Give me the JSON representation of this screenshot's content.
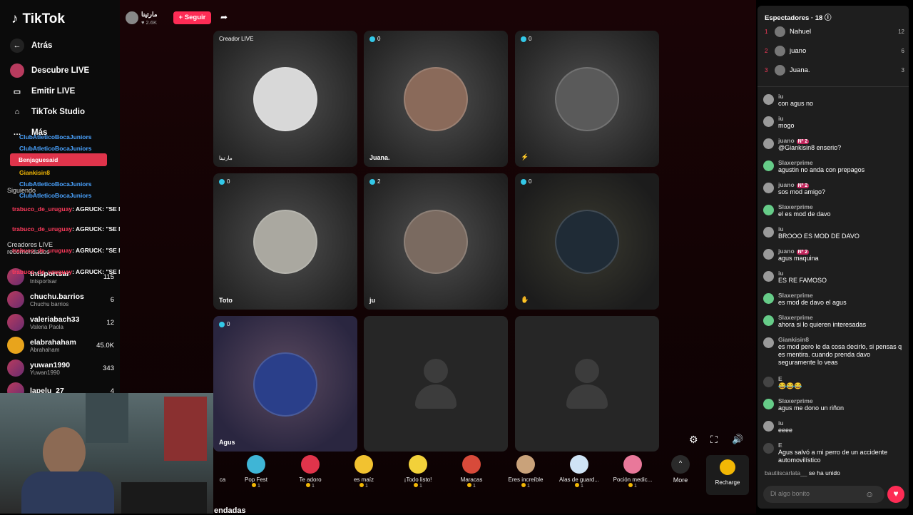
{
  "app": {
    "name": "TikTok"
  },
  "sidebar": {
    "back": "Atrás",
    "nav": [
      "Descubre LIVE",
      "Emitir LIVE",
      "TikTok Studio",
      "Más"
    ],
    "following_label": "Siguiendo",
    "recommended_label": "Creadores LIVE recomendados",
    "creators": [
      {
        "name": "tntsportsar",
        "sub": "tntsportsar",
        "count": "115"
      },
      {
        "name": "chuchu.barrios",
        "sub": "Chuchu barrios",
        "count": "6"
      },
      {
        "name": "valeriabach33",
        "sub": "Valeria Paola",
        "count": "12"
      },
      {
        "name": "elabrahaham",
        "sub": "Abrahaham",
        "count": "45.0K"
      },
      {
        "name": "yuwan1990",
        "sub": "Yuwan1990",
        "count": "343"
      },
      {
        "name": "lapelu_27",
        "sub": "",
        "count": "4"
      }
    ]
  },
  "overlay": {
    "users": [
      "ClubAtleticoBocaJuniors",
      "ClubAtleticoBocaJuniors",
      "Benjaguesaid",
      "Giankisin8",
      "ClubAtleticoBocaJuniors",
      "ClubAtleticoBocaJuniors"
    ],
    "messages": [
      {
        "user": "trabuco_de_uruguay",
        "text": ": AGRUCK: \"SE ME ESCUCHAN BIEN?\" LOS PIBES:"
      },
      {
        "user": "trabuco_de_uruguay",
        "text": ": AGRUCK: \"SE ME ESCUCHAN BIEN?\" LOS PIBES:"
      },
      {
        "user": "trabuco_de_uruguay",
        "text": ": AGRUCK: \"SE ME ESCUCHAN BIEN?\" LOS PIBES:"
      },
      {
        "user": "trabuco_de_uruguay",
        "text": ": AGRUCK: \"SE ME ESCUCHAN BIEN?\" LOS PIBES:"
      }
    ]
  },
  "header": {
    "host": "مارتينا",
    "likes": "2.6K",
    "follow": "+ Seguir"
  },
  "tiles": [
    {
      "label": "Creador LIVE",
      "name": "مارتينا",
      "color": "#d8d8d8"
    },
    {
      "label": "0",
      "name": "Juana.",
      "color": "#8a6a5a"
    },
    {
      "label": "0",
      "name": "",
      "color": "#444"
    },
    {
      "label": "0",
      "name": "Toto",
      "color": "#aaa8a0"
    },
    {
      "label": "2",
      "name": "ju",
      "color": "#7a6a60"
    },
    {
      "label": "0",
      "name": "",
      "color": "#1f2b36"
    },
    {
      "label": "0",
      "name": "Agus",
      "color": "#2a3f8a"
    },
    {
      "label": "",
      "name": "",
      "color": ""
    },
    {
      "label": "",
      "name": "",
      "color": ""
    }
  ],
  "gifts": [
    {
      "label": "ca",
      "price": "",
      "color": "#6a4"
    },
    {
      "label": "Pop Fest",
      "price": "1",
      "color": "#3fb5d6"
    },
    {
      "label": "Te adoro",
      "price": "1",
      "color": "#e0344b"
    },
    {
      "label": "es maíz",
      "price": "1",
      "color": "#f2c230"
    },
    {
      "label": "¡Todo listo!",
      "price": "1",
      "color": "#f2d13a"
    },
    {
      "label": "Maracas",
      "price": "1",
      "color": "#d84a3a"
    },
    {
      "label": "Eres increíble",
      "price": "1",
      "color": "#c9a27a"
    },
    {
      "label": "Alas de guard...",
      "price": "1",
      "color": "#cfe3f5"
    },
    {
      "label": "Poción medic...",
      "price": "1",
      "color": "#e9789a"
    }
  ],
  "more_label": "More",
  "recharge_label": "Recharge",
  "bottom_heading": "endadas",
  "viewers": {
    "title": "Espectadores · 18",
    "list": [
      {
        "rank": "1",
        "name": "Nahuel",
        "score": "12"
      },
      {
        "rank": "2",
        "name": "juano",
        "score": "6"
      },
      {
        "rank": "3",
        "name": "Juana.",
        "score": "3"
      }
    ]
  },
  "comments": [
    {
      "user": "iu",
      "text": "con agus no"
    },
    {
      "user": "iu",
      "text": "mogo"
    },
    {
      "user": "juano",
      "badge": "Nº 2",
      "text": "@Giankisin8 enserio?"
    },
    {
      "user": "Slaxerprime",
      "text": "agustin no anda con prepagos"
    },
    {
      "user": "juano",
      "badge": "Nº 2",
      "text": "sos mod amigo?"
    },
    {
      "user": "Slaxerprime",
      "text": "el es mod de davo"
    },
    {
      "user": "iu",
      "text": "BROOO ES MOD DE DAVO"
    },
    {
      "user": "juano",
      "badge": "Nº 2",
      "text": "agus maquina"
    },
    {
      "user": "iu",
      "text": "ES RE FAMOSO"
    },
    {
      "user": "Slaxerprime",
      "text": "es mod de davo el agus"
    },
    {
      "user": "Slaxerprime",
      "text": "ahora si lo quieren interesadas"
    },
    {
      "user": "Giankisin8",
      "text": "es mod pero le da cosa decirlo, si pensas q es mentira. cuando prenda davo seguramente lo veas"
    },
    {
      "user": "E",
      "text": "😂😂😂"
    },
    {
      "user": "Slaxerprime",
      "text": "agus me dono un riñon"
    },
    {
      "user": "iu",
      "text": "eeee"
    },
    {
      "user": "E",
      "text": "Agus salvó a mi perro de un accidente automovilístico"
    }
  ],
  "join": {
    "user": "bautiiscarlata__",
    "text": "se ha unido"
  },
  "chat_input_placeholder": "Di algo bonito"
}
